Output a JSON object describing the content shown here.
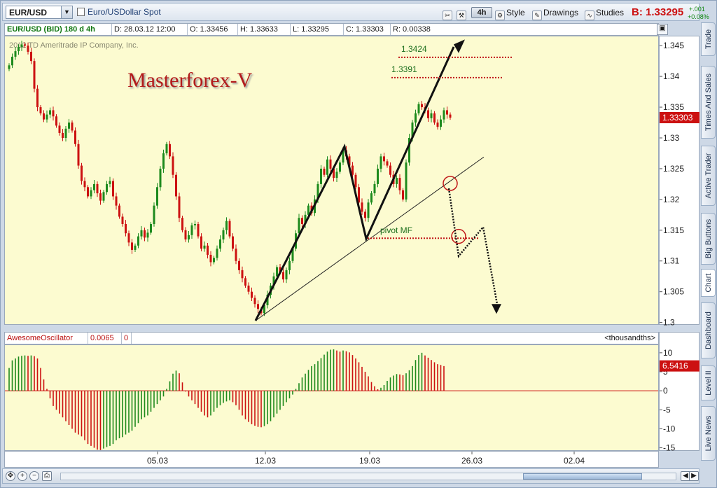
{
  "toolbar": {
    "symbol": "EUR/USD",
    "description": "Euro/USDollar Spot",
    "timeframe": "4h",
    "style_label": "Style",
    "drawings_label": "Drawings",
    "studies_label": "Studies",
    "bid_label": "B: 1.33295",
    "change_abs": "+.001",
    "change_pct": "+0.08%"
  },
  "info_bar": {
    "series": "EUR/USD (BID) 180 d 4h",
    "date": "D: 28.03.12 12:00",
    "open": "O: 1.33456",
    "high": "H: 1.33633",
    "low": "L: 1.33295",
    "close": "C: 1.33303",
    "range": "R: 0.00338"
  },
  "watermark": "2012 TD Ameritrade IP Company, Inc.",
  "annotation_title": "Masterforex-V",
  "last_price_tag": "1.33303",
  "osc_bar": {
    "name": "AwesomeOscillator",
    "value": "0.0065",
    "zero": "0",
    "units": "<thousandths>"
  },
  "osc_value_tag": "6.5416",
  "side_tabs": [
    "Trade",
    "Times And Sales",
    "Active Trader",
    "Big Buttons",
    "Chart",
    "Dashboard",
    "Level II",
    "Live News"
  ],
  "colors": {
    "up": "#1d8a1d",
    "down": "#cc1111",
    "background": "#fcfbd0"
  },
  "chart_data": [
    {
      "type": "candlestick",
      "title": "",
      "ylim": [
        1.2995,
        1.3465
      ],
      "yticks": [
        1.3,
        1.305,
        1.31,
        1.315,
        1.32,
        1.325,
        1.33,
        1.335,
        1.34,
        1.345
      ],
      "ytick_labels": [
        "1.3",
        "1.305",
        "1.31",
        "1.315",
        "1.32",
        "1.325",
        "1.33",
        "1.335",
        "1.34",
        "1.345"
      ],
      "xticks": [
        "05.03",
        "12.03",
        "19.03",
        "26.03",
        "02.04"
      ],
      "closes": [
        1.3418,
        1.3432,
        1.3441,
        1.3448,
        1.3452,
        1.345,
        1.344,
        1.3425,
        1.338,
        1.335,
        1.334,
        1.333,
        1.3338,
        1.3345,
        1.3335,
        1.332,
        1.3308,
        1.33,
        1.3315,
        1.3325,
        1.3312,
        1.329,
        1.3255,
        1.323,
        1.322,
        1.3205,
        1.3215,
        1.3225,
        1.321,
        1.3198,
        1.3212,
        1.3225,
        1.323,
        1.3205,
        1.319,
        1.3172,
        1.316,
        1.3145,
        1.313,
        1.3118,
        1.3125,
        1.314,
        1.315,
        1.3138,
        1.3146,
        1.316,
        1.319,
        1.322,
        1.325,
        1.3275,
        1.329,
        1.327,
        1.324,
        1.3205,
        1.317,
        1.315,
        1.3135,
        1.3142,
        1.3158,
        1.316,
        1.314,
        1.312,
        1.3125,
        1.311,
        1.3098,
        1.3105,
        1.312,
        1.3135,
        1.315,
        1.3165,
        1.314,
        1.312,
        1.31,
        1.3085,
        1.3072,
        1.306,
        1.305,
        1.304,
        1.303,
        1.3022,
        1.3015,
        1.3028,
        1.3045,
        1.306,
        1.3075,
        1.309,
        1.3082,
        1.307,
        1.3085,
        1.31,
        1.312,
        1.3145,
        1.317,
        1.316,
        1.3175,
        1.319,
        1.3178,
        1.32,
        1.3225,
        1.325,
        1.324,
        1.3265,
        1.325,
        1.3235,
        1.3245,
        1.326,
        1.328,
        1.327,
        1.3255,
        1.324,
        1.322,
        1.3195,
        1.318,
        1.317,
        1.3195,
        1.321,
        1.3225,
        1.325,
        1.327,
        1.3262,
        1.3255,
        1.324,
        1.3225,
        1.3235,
        1.3215,
        1.32,
        1.326,
        1.33,
        1.3325,
        1.334,
        1.3355,
        1.335,
        1.3345,
        1.3332,
        1.334,
        1.3325,
        1.3318,
        1.333,
        1.3345,
        1.3338,
        1.3333
      ]
    },
    {
      "type": "bar",
      "title": "AwesomeOscillator",
      "ylim": [
        -16,
        12
      ],
      "yticks": [
        10,
        5,
        0,
        -5,
        -10,
        -15
      ],
      "ytick_labels": [
        "10",
        "5",
        "0",
        "-5",
        "-10",
        "-15"
      ],
      "values": [
        6,
        8,
        8.5,
        9,
        9.2,
        9.3,
        9.2,
        9.3,
        9.1,
        8.5,
        6,
        3,
        0.5,
        -2,
        -4,
        -5,
        -6,
        -7,
        -8,
        -9,
        -10,
        -11,
        -11.5,
        -12,
        -13,
        -14,
        -14.5,
        -15,
        -15.5,
        -15.6,
        -15.2,
        -14.8,
        -14.5,
        -14,
        -13,
        -12.5,
        -12.2,
        -11.5,
        -11,
        -10.5,
        -9.5,
        -8.5,
        -7.5,
        -7,
        -6.5,
        -5.5,
        -4.5,
        -3.5,
        -2.5,
        -1.5,
        0.5,
        2.5,
        4.5,
        5.3,
        4.6,
        2.2,
        -0.2,
        -1.5,
        -2.5,
        -3.5,
        -4.5,
        -5.5,
        -6.5,
        -7,
        -6.5,
        -5.5,
        -4.5,
        -3.8,
        -3.2,
        -2.8,
        -2.5,
        -3,
        -3.8,
        -5,
        -6.5,
        -7.5,
        -8.2,
        -8.8,
        -9.2,
        -9.5,
        -9.6,
        -9.3,
        -8.8,
        -8,
        -7,
        -6,
        -5,
        -4,
        -3,
        -2,
        -1,
        0.5,
        2,
        3.5,
        4.5,
        5.5,
        6.5,
        7,
        7.8,
        8.6,
        9.5,
        10.3,
        10.8,
        10.9,
        10.6,
        10.3,
        10.6,
        10.4,
        10.1,
        9.4,
        8.5,
        7.5,
        6.3,
        5,
        3.8,
        2.3,
        1.2,
        0.4,
        0.8,
        1.5,
        2.6,
        3.5,
        4,
        4.4,
        4.3,
        4.1,
        4.6,
        5.4,
        6.5,
        8.1,
        9.4,
        10,
        9.3,
        8.7,
        8.1,
        7.5,
        7,
        6.8,
        6.5
      ]
    }
  ]
}
